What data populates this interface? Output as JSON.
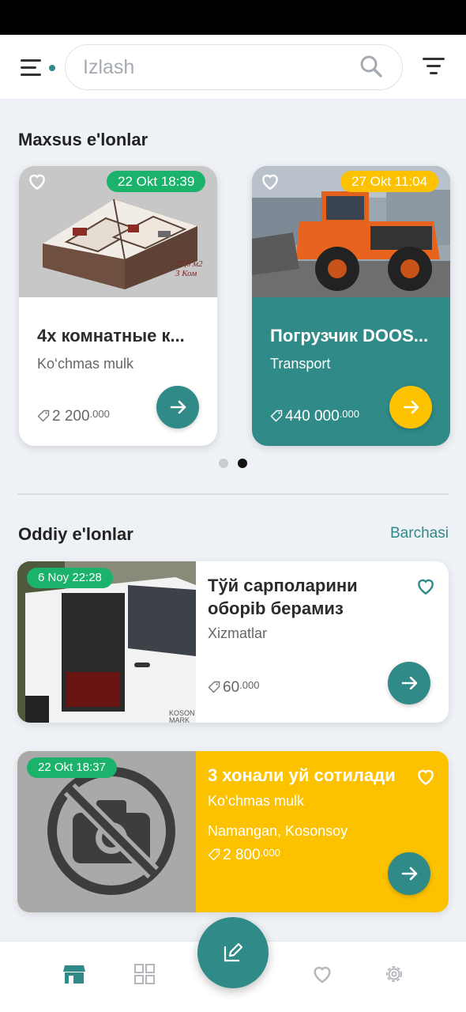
{
  "search": {
    "placeholder": "Izlash"
  },
  "featured": {
    "title": "Maxsus e'lonlar",
    "cards": [
      {
        "date": "22 Okt 18:39",
        "title": "4х комнатные к...",
        "category": "Ko‘chmas mulk",
        "price_main": "2 200",
        "price_sup": ".000",
        "image": "apartment-3d-plan",
        "image_caption": "77,6 м2 3 Ком"
      },
      {
        "date": "27 Okt 11:04",
        "title": "Погрузчик DOOS...",
        "category": "Transport",
        "price_main": "440 000",
        "price_sup": ".000",
        "image": "orange-wheel-loader"
      }
    ],
    "active_dot": 2
  },
  "listings": {
    "title": "Oddiy e'lonlar",
    "see_all": "Barchasi",
    "cards": [
      {
        "date": "6 Noy 22:28",
        "title": "Тўй сарполарини оборib берамиз",
        "category": "Xizmatlar",
        "price_main": "60",
        "price_sup": ".000",
        "image": "white-van-open-door",
        "watermark": "KOSON MARK"
      },
      {
        "date": "22 Okt 18:37",
        "title": "3 хонали уй сотилади",
        "category": "Ko‘chmas mulk",
        "location": "Namangan, Kosonsoy",
        "price_main": "2 800",
        "price_sup": ".000",
        "image": "no-photo-placeholder"
      }
    ]
  },
  "bottom_nav": {
    "items": [
      "store-icon",
      "grid-icon",
      "edit-icon",
      "heart-icon",
      "gear-icon"
    ]
  },
  "colors": {
    "teal": "#2f8a88",
    "yellow": "#fcc200",
    "green_badge": "#1bb26b"
  }
}
